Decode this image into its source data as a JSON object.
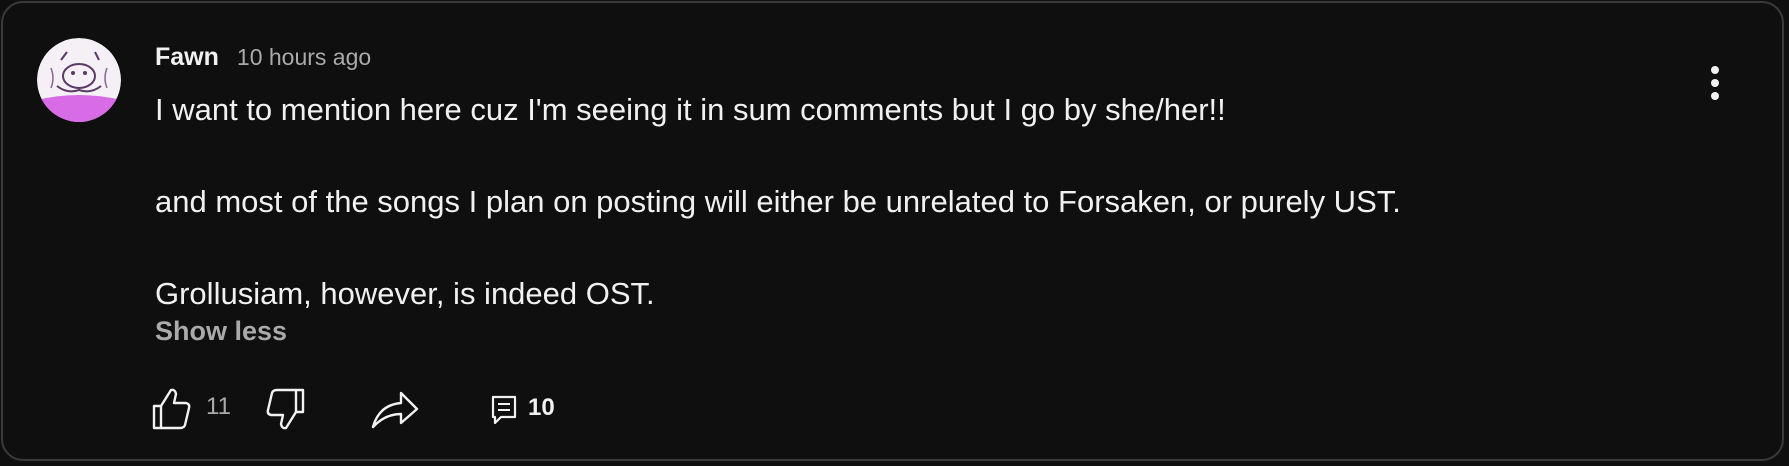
{
  "comment": {
    "author": "Fawn",
    "timestamp": "10 hours ago",
    "lines": [
      "I want to mention here cuz I'm seeing it in sum comments but I go by she/her!!",
      "and most of the songs I plan on posting will either be unrelated to Forsaken, or purely UST.",
      "Grollusiam, however, is indeed OST."
    ],
    "show_less_label": "Show less",
    "like_count": "11",
    "reply_count": "10"
  },
  "icons": {
    "avatar": "avatar-image",
    "like": "thumbs-up-icon",
    "dislike": "thumbs-down-icon",
    "share": "share-arrow-icon",
    "reply": "comment-icon",
    "menu": "more-vertical-icon"
  },
  "colors": {
    "background": "#0f0f0f",
    "text_primary": "#f1f1f1",
    "text_secondary": "#aaaaaa",
    "avatar_accent": "#d86be6"
  }
}
